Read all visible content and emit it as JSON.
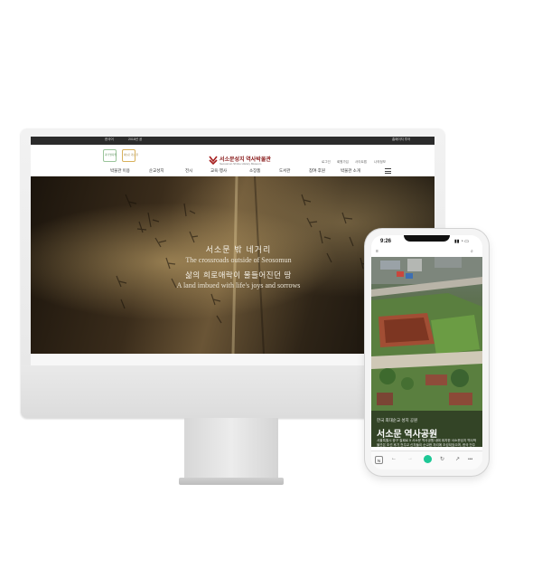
{
  "site": {
    "topbar": {
      "left_a": "한국어",
      "left_b": "2018년 공",
      "right": "홈페이지 투어"
    },
    "header": {
      "logo1": "과거 발자취",
      "logo2": "하늘로 가는 길",
      "brand_name": "서소문성지 역사박물관",
      "brand_sub": "Seosomun Shrine History Museum",
      "utility": [
        "로그인",
        "회원가입",
        "사이트맵",
        "나의정보"
      ]
    },
    "nav": [
      "박물관 이용",
      "순교성지",
      "전시",
      "교육·행사",
      "소장품",
      "도서관",
      "참여·후원",
      "박물관 소개"
    ],
    "hero": {
      "ko_line1": "서소문 밖 네거리",
      "en_line1": "The crossroads outside of Seosomun",
      "ko_line2": "삶의 희로애락이 물들어진던 땅",
      "en_line2": "A land imbued with life's joys and sorrows"
    }
  },
  "mobile": {
    "status_time": "9:26",
    "status_icons": "▮▮ ◔ ▭",
    "kicker": "한국 최대순교 성지 공원",
    "title": "서소문 역사공원",
    "description": "서울특별시 중구 칠패로 5 서소문 역사공원 내에 위치한 서소문성지 역사박물관은 조선 후기 천주교 신자들이 순교한 자리에 조성되었으며, 한국 천주교의 역사와 정신을 기리는 공간입니다.",
    "arrows": "‹ ›",
    "toolbar": {
      "naver": "N",
      "back": "←",
      "forward": "→",
      "refresh": "↻",
      "share": "↗",
      "more": "•••"
    }
  },
  "colors": {
    "brand": "#8a1c1c",
    "topbar": "#2b2b2b",
    "toolbar_accent": "#1ec896"
  }
}
